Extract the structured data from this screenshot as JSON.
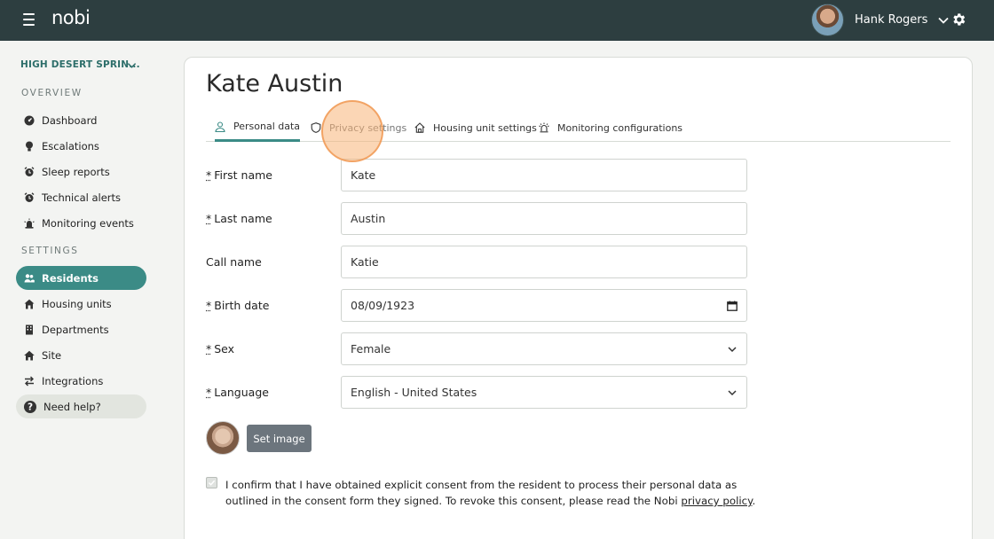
{
  "app": {
    "logo": "nobi"
  },
  "topbar": {
    "user_name": "Hank Rogers"
  },
  "sidebar": {
    "site_name": "HIGH DESERT SPRIN...",
    "overview_label": "OVERVIEW",
    "settings_label": "SETTINGS",
    "overview_items": [
      {
        "label": "Dashboard",
        "icon": "dashboard-icon"
      },
      {
        "label": "Escalations",
        "icon": "bulb-icon"
      },
      {
        "label": "Sleep reports",
        "icon": "alarm-clock-icon"
      },
      {
        "label": "Technical alerts",
        "icon": "alarm-clock-icon"
      },
      {
        "label": "Monitoring events",
        "icon": "siren-icon"
      }
    ],
    "settings_items": [
      {
        "label": "Residents",
        "icon": "users-icon",
        "active": true
      },
      {
        "label": "Housing units",
        "icon": "house-icon"
      },
      {
        "label": "Departments",
        "icon": "building-icon"
      },
      {
        "label": "Site",
        "icon": "home-icon"
      },
      {
        "label": "Integrations",
        "icon": "arrows-icon"
      }
    ],
    "help_label": "Need help?"
  },
  "main": {
    "title": "Kate Austin",
    "tabs": [
      {
        "label": "Personal data",
        "icon": "user-icon",
        "active": true
      },
      {
        "label": "Privacy settings",
        "icon": "shield-icon"
      },
      {
        "label": "Housing unit settings",
        "icon": "house-icon"
      },
      {
        "label": "Monitoring configurations",
        "icon": "siren-icon"
      }
    ],
    "fields": {
      "first_name": {
        "label": "First name",
        "value": "Kate",
        "required": true
      },
      "last_name": {
        "label": "Last name",
        "value": "Austin",
        "required": true
      },
      "call_name": {
        "label": "Call name",
        "value": "Katie",
        "required": false
      },
      "birth_date": {
        "label": "Birth date",
        "value": "08/09/1923",
        "required": true
      },
      "sex": {
        "label": "Sex",
        "value": "Female",
        "required": true
      },
      "language": {
        "label": "Language",
        "value": "English - United States",
        "required": true
      }
    },
    "required_marker": "*",
    "set_image_label": "Set image",
    "consent_text": "I confirm that I have obtained explicit consent from the resident to process their personal data as outlined in the consent form they signed. To revoke this consent, please read the Nobi ",
    "consent_link": "privacy policy",
    "consent_end": "."
  },
  "colors": {
    "topbar": "#2d3e40",
    "accent": "#3b8b86",
    "highlight": "#f7b478"
  }
}
